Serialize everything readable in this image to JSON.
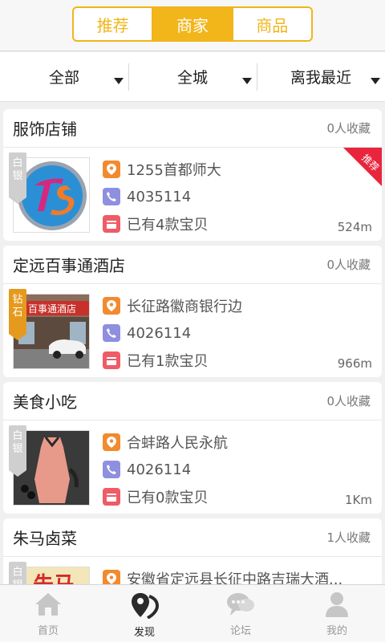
{
  "tabs": [
    {
      "label": "推荐",
      "active": false
    },
    {
      "label": "商家",
      "active": true
    },
    {
      "label": "商品",
      "active": false
    }
  ],
  "filters": [
    {
      "label": "全部"
    },
    {
      "label": "全城"
    },
    {
      "label": "离我最近"
    }
  ],
  "stores": [
    {
      "name": "服饰店铺",
      "favorites": "0人收藏",
      "badge": "白银",
      "badge_tier": "silver",
      "address": "1255首都师大",
      "phone": "4035114",
      "items": "已有4款宝贝",
      "distance": "524m",
      "recommended": true,
      "recommended_label": "推荐",
      "thumb": "ts-logo"
    },
    {
      "name": "定远百事通酒店",
      "favorites": "0人收藏",
      "badge": "钻石",
      "badge_tier": "gold",
      "address": "长征路徽商银行边",
      "phone": "4026114",
      "items": "已有1款宝贝",
      "distance": "966m",
      "recommended": false,
      "thumb": "hotel-photo",
      "thumb_sign": "百事通酒店"
    },
    {
      "name": "美食小吃",
      "favorites": "0人收藏",
      "badge": "白银",
      "badge_tier": "silver",
      "address": "合蚌路人民永航",
      "phone": "4026114",
      "items": "已有0款宝贝",
      "distance": "1Km",
      "recommended": false,
      "thumb": "dress-photo"
    },
    {
      "name": "朱马卤菜",
      "favorites": "1人收藏",
      "badge": "白银",
      "badge_tier": "silver",
      "address": "安徽省定远县长征中路吉瑞大酒...",
      "recommended": false,
      "thumb": "sign-photo",
      "thumb_sign": "朱马"
    }
  ],
  "nav": [
    {
      "label": "首页",
      "icon": "home-icon",
      "active": false
    },
    {
      "label": "发现",
      "icon": "discover-pin-icon",
      "active": true
    },
    {
      "label": "论坛",
      "icon": "chat-bubbles-icon",
      "active": false
    },
    {
      "label": "我的",
      "icon": "person-icon",
      "active": false
    }
  ],
  "colors": {
    "accent": "#f2b51a",
    "recommend": "#e8253c",
    "pin": "#f28a2e",
    "phone": "#8f8fe0",
    "gift": "#ef5b67"
  }
}
